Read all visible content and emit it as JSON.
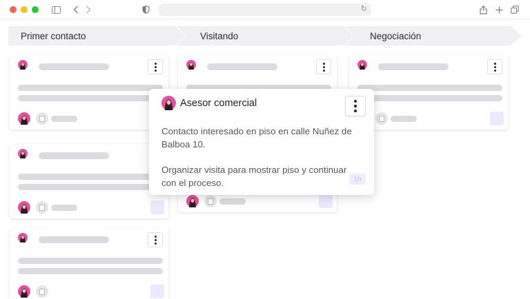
{
  "browser": {
    "icons": [
      "sidebar-icon",
      "back-icon",
      "forward-icon",
      "shield-icon",
      "reload-icon",
      "share-icon",
      "new-tab-icon",
      "tabs-overview-icon"
    ]
  },
  "stages": [
    {
      "label": "Primer contacto"
    },
    {
      "label": "Visitando"
    },
    {
      "label": "Negociación"
    }
  ],
  "popover": {
    "title": "Asesor comercial",
    "description_1": "Contacto interesado en piso en calle Nuñez de Balboa 10.",
    "description_2": "Organizar visita para mostrar piso y continuar con el proceso.",
    "time_badge": "1h"
  },
  "colors": {
    "accent_light": "#ebeafc",
    "skeleton": "#dcdce0",
    "avatar_pink": "#e052a0"
  }
}
